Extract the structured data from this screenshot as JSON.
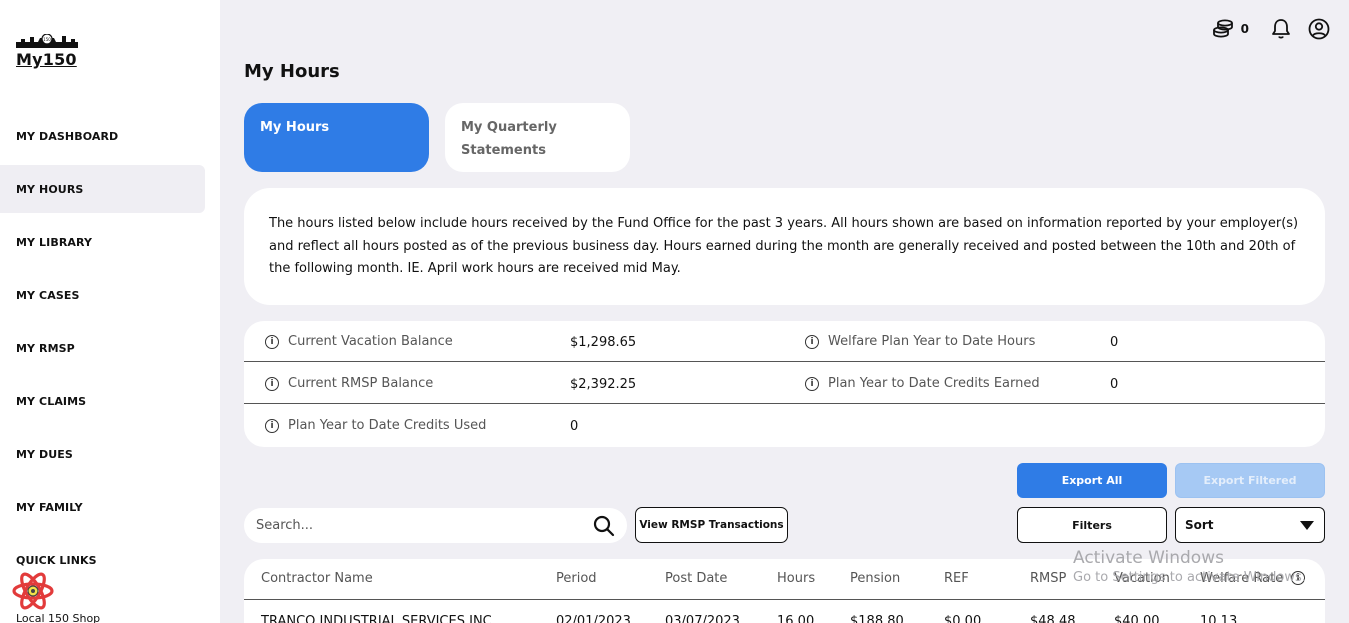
{
  "sidebar": {
    "brand": "My150",
    "items": [
      {
        "label": "MY DASHBOARD"
      },
      {
        "label": "MY HOURS"
      },
      {
        "label": "MY LIBRARY"
      },
      {
        "label": "MY CASES"
      },
      {
        "label": "MY RMSP"
      },
      {
        "label": "MY CLAIMS"
      },
      {
        "label": "MY DUES"
      },
      {
        "label": "MY FAMILY"
      },
      {
        "label": "QUICK LINKS"
      }
    ],
    "active_item": "MY HOURS",
    "shop_link": "Local 150 Shop"
  },
  "topbar": {
    "coins_count": "0",
    "icons": [
      "coins-icon",
      "bell-icon",
      "account-icon"
    ]
  },
  "page": {
    "title": "My Hours",
    "tabs": [
      {
        "label": "My Hours",
        "active": true
      },
      {
        "label": "My Quarterly Statements",
        "active": false
      }
    ],
    "info_text": "The hours listed below include hours received by the Fund Office for the past 3 years. All hours shown are based on information reported by your employer(s) and reflect all hours posted as of the previous business day. Hours earned during the month are generally received and posted between the 10th and 20th of the following month. IE. April work hours are received mid May."
  },
  "balances": {
    "current_vacation_balance": {
      "label": "Current Vacation Balance",
      "value": "$1,298.65"
    },
    "welfare_plan_ytd_hours": {
      "label": "Welfare Plan Year to Date Hours",
      "value": "0"
    },
    "current_rmsp_balance": {
      "label": "Current RMSP Balance",
      "value": "$2,392.25"
    },
    "plan_ytd_credits_earned": {
      "label": "Plan Year to Date Credits Earned",
      "value": "0"
    },
    "plan_ytd_credits_used": {
      "label": "Plan Year to Date Credits Used",
      "value": "0"
    }
  },
  "actions": {
    "export_all": "Export All",
    "export_filtered": "Export Filtered",
    "filters": "Filters",
    "sort": "Sort",
    "view_rmsp": "View RMSP Transactions",
    "search_placeholder": "Search..."
  },
  "table": {
    "columns": [
      "Contractor Name",
      "Period",
      "Post Date",
      "Hours",
      "Pension",
      "REF",
      "RMSP",
      "Vacation",
      "Welfare Rate"
    ],
    "rows": [
      [
        "TRANCO INDUSTRIAL SERVICES INC",
        "02/01/2023",
        "03/07/2023",
        "16.00",
        "$188.80",
        "$0.00",
        "$48.48",
        "$40.00",
        "10.13"
      ]
    ]
  },
  "watermark": {
    "line1": "Activate Windows",
    "line2": "Go to Settings to activate Windows."
  },
  "colors": {
    "accent": "#2f7ce6",
    "background": "#f0eff4",
    "disabled_button": "#a6c9f4"
  }
}
